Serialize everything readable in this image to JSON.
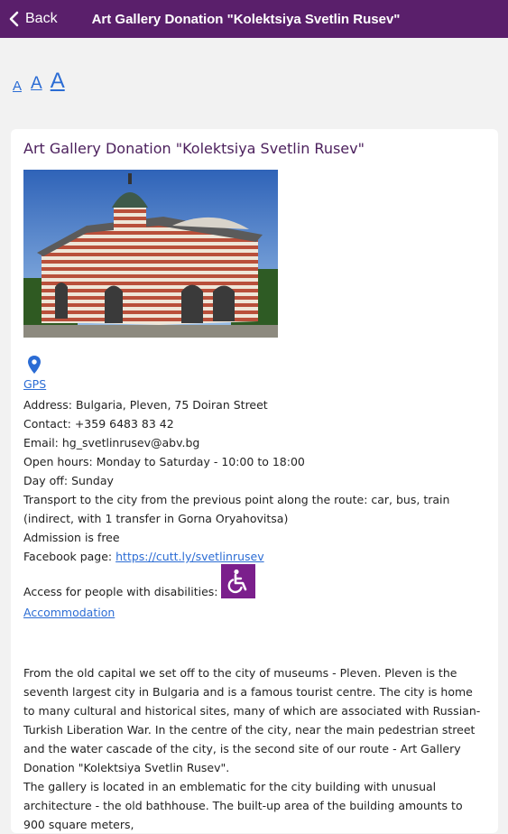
{
  "header": {
    "back_label": "Back",
    "title": "Art Gallery Donation \"Kolektsiya Svetlin Rusev\""
  },
  "font_controls": {
    "small": "A",
    "medium": "A",
    "large": "A"
  },
  "card": {
    "title": "Art Gallery Donation \"Kolektsiya Svetlin Rusev\"",
    "gps_label": "GPS",
    "address": "Address: Bulgaria, Pleven, 75 Doiran Street",
    "contact": "Contact: +359 6483 83 42",
    "email": "Email: hg_svetlinrusev@abv.bg",
    "open_hours": "Open hours: Monday to Saturday - 10:00 to 18:00",
    "day_off": "Day off: Sunday",
    "transport": "Transport to the city from the previous point along the route: car, bus, train (indirect, with 1 transfer in Gorna Oryahovitsa)",
    "admission": "Admission is free",
    "facebook_label": "Facebook page: ",
    "facebook_link": "https://cutt.ly/svetlinrusev",
    "access_label": "Access for people with disabilities:",
    "accommodation_link": "Accommodation",
    "description_1": "From the old capital we set off to the city of museums - Pleven. Pleven is the seventh largest city in Bulgaria and is a famous tourist centre. The city is home to many cultural and historical sites, many of which are associated with Russian-Turkish Liberation War. In the centre of the city, near the main pedestrian street and the water cascade of the city, is the second site of our route - Art Gallery Donation \"Kolektsiya Svetlin Rusev\".",
    "description_2": "The gallery is located in an emblematic for the city building with unusual architecture - the old bathhouse. The built-up area of the building amounts to 900 square meters,"
  },
  "icons": {
    "back": "chevron-left-icon",
    "pin": "map-pin-icon",
    "accessibility": "wheelchair-icon"
  },
  "colors": {
    "header": "#5a1f6b",
    "link": "#2b6cd4",
    "accent": "#7b1f8c",
    "title": "#4b1f5c"
  }
}
